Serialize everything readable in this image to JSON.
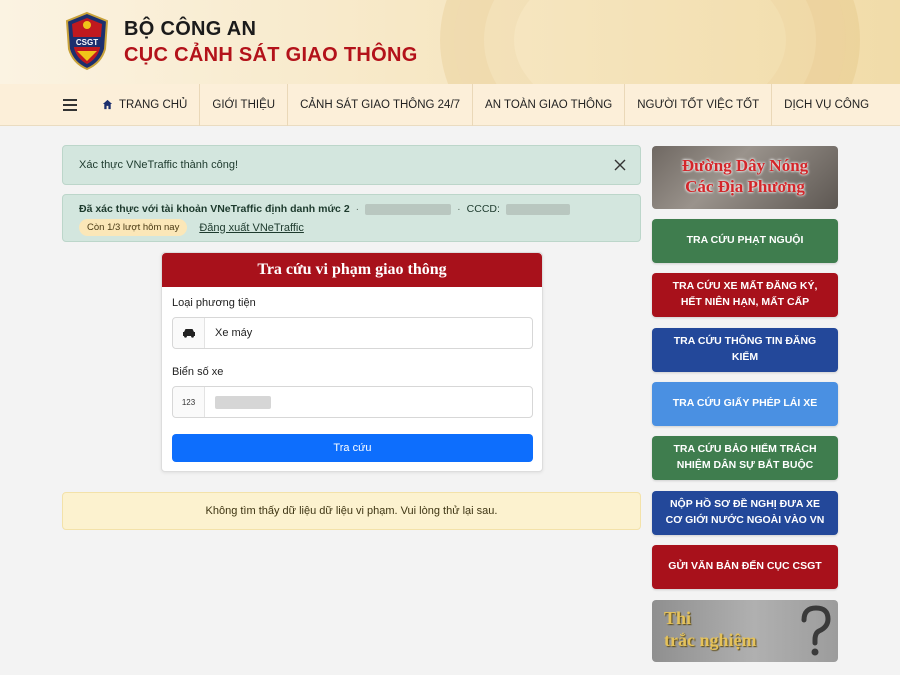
{
  "header": {
    "logo_text": "CSGT",
    "ministry": "BỘ CÔNG AN",
    "department": "CỤC CẢNH SÁT GIAO THÔNG"
  },
  "nav": {
    "items": [
      {
        "label": "TRANG CHỦ",
        "icon": "home-icon"
      },
      {
        "label": "GIỚI THIỆU"
      },
      {
        "label": "CẢNH SÁT GIAO THÔNG 24/7"
      },
      {
        "label": "AN TOÀN GIAO THÔNG"
      },
      {
        "label": "NGƯỜI TỐT VIỆC TỐT"
      },
      {
        "label": "DỊCH VỤ CÔNG"
      }
    ]
  },
  "alerts": {
    "success": "Xác thực VNeTraffic thành công!",
    "verified_prefix": "Đã xác thực với tài khoản VNeTraffic định danh mức 2",
    "cccd_label": "CCCD:",
    "remaining": "Còn 1/3 lượt hôm nay",
    "logout": "Đăng xuất VNeTraffic",
    "not_found": "Không tìm thấy dữ liệu dữ liệu vi phạm. Vui lòng thử lại sau."
  },
  "form": {
    "title": "Tra cứu vi phạm giao thông",
    "vehicle_label": "Loại phương tiện",
    "vehicle_value": "Xe máy",
    "plate_label": "Biển số xe",
    "plate_addon": "123",
    "submit": "Tra cứu"
  },
  "sidebar": {
    "hotline_line1": "Đường Dây Nóng",
    "hotline_line2": "Các Địa Phương",
    "buttons": [
      {
        "label": "TRA CỨU PHẠT NGUỘI",
        "color": "#3f7d4e"
      },
      {
        "label": "TRA CỨU XE MẤT ĐĂNG KÝ, HẾT NIÊN HẠN, MẤT CẤP",
        "color": "#a8111b"
      },
      {
        "label": "TRA CỨU THÔNG TIN ĐĂNG KIỂM",
        "color": "#23489a"
      },
      {
        "label": "TRA CỨU GIẤY PHÉP LÁI XE",
        "color": "#4a90e2"
      },
      {
        "label": "TRA CỨU BẢO HIỂM TRÁCH NHIỆM DÂN SỰ BẮT BUỘC",
        "color": "#3f7d4e"
      },
      {
        "label": "NỘP HỒ SƠ ĐỀ NGHỊ ĐƯA XE CƠ GIỚI NƯỚC NGOÀI VÀO VN",
        "color": "#23489a"
      },
      {
        "label": "GỬI VĂN BẢN ĐẾN CỤC CSGT",
        "color": "#a8111b"
      }
    ],
    "quiz_line1": "Thi",
    "quiz_line2": "trắc nghiệm"
  }
}
